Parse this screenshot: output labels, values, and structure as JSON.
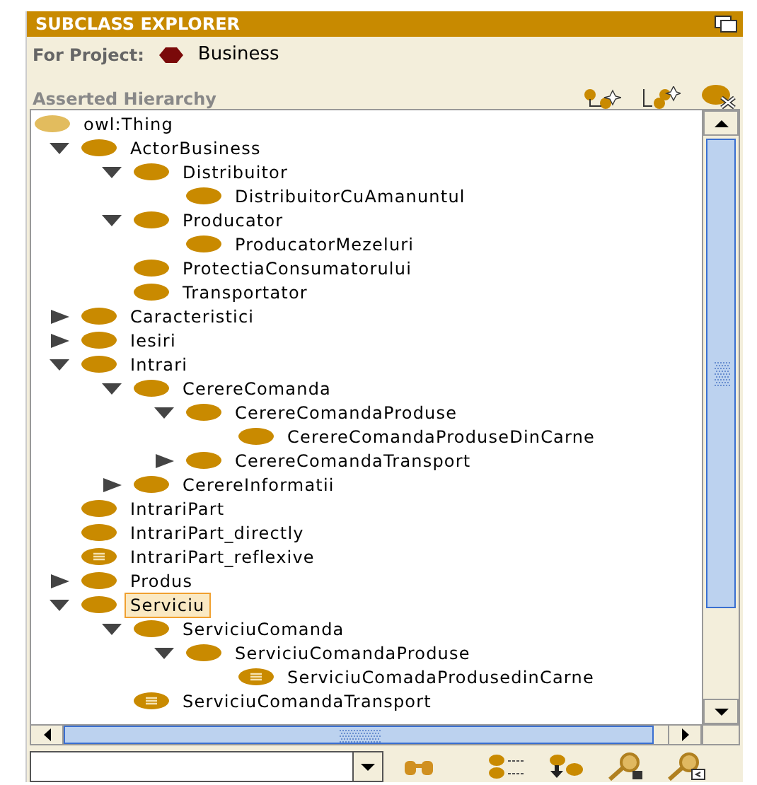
{
  "panel": {
    "title": "SUBCLASS EXPLORER",
    "project_label": "For Project:",
    "project_name": "Business",
    "hierarchy_label": "Asserted Hierarchy"
  },
  "tree": [
    {
      "label": "owl:Thing",
      "kind": "root",
      "children": [
        {
          "label": "ActorBusiness",
          "kind": "class",
          "expanded": true,
          "children": [
            {
              "label": "Distribuitor",
              "kind": "class",
              "expanded": true,
              "children": [
                {
                  "label": "DistribuitorCuAmanuntul",
                  "kind": "class"
                }
              ]
            },
            {
              "label": "Producator",
              "kind": "class",
              "expanded": true,
              "children": [
                {
                  "label": "ProducatorMezeluri",
                  "kind": "class"
                }
              ]
            },
            {
              "label": "ProtectiaConsumatorului",
              "kind": "class"
            },
            {
              "label": "Transportator",
              "kind": "class"
            }
          ]
        },
        {
          "label": "Caracteristici",
          "kind": "class",
          "expanded": false
        },
        {
          "label": "Iesiri",
          "kind": "class",
          "expanded": false
        },
        {
          "label": "Intrari",
          "kind": "class",
          "expanded": true,
          "children": [
            {
              "label": "CerereComanda",
              "kind": "class",
              "expanded": true,
              "children": [
                {
                  "label": "CerereComandaProduse",
                  "kind": "class",
                  "expanded": true,
                  "children": [
                    {
                      "label": "CerereComandaProduseDinCarne",
                      "kind": "class"
                    }
                  ]
                },
                {
                  "label": "CerereComandaTransport",
                  "kind": "class",
                  "expanded": false
                }
              ]
            },
            {
              "label": "CerereInformatii",
              "kind": "class",
              "expanded": false
            }
          ]
        },
        {
          "label": "IntrariPart",
          "kind": "class"
        },
        {
          "label": "IntrariPart_directly",
          "kind": "class"
        },
        {
          "label": "IntrariPart_reflexive",
          "kind": "defined"
        },
        {
          "label": "Produs",
          "kind": "class",
          "expanded": false
        },
        {
          "label": "Serviciu",
          "kind": "class",
          "expanded": true,
          "selected": true,
          "children": [
            {
              "label": "ServiciuComanda",
              "kind": "class",
              "expanded": true,
              "children": [
                {
                  "label": "ServiciuComandaProduse",
                  "kind": "class",
                  "expanded": true,
                  "children": [
                    {
                      "label": "ServiciuComadaProdusedinCarne",
                      "kind": "defined"
                    }
                  ]
                }
              ]
            },
            {
              "label": "ServiciuComandaTransport",
              "kind": "defined"
            }
          ]
        }
      ]
    }
  ]
}
